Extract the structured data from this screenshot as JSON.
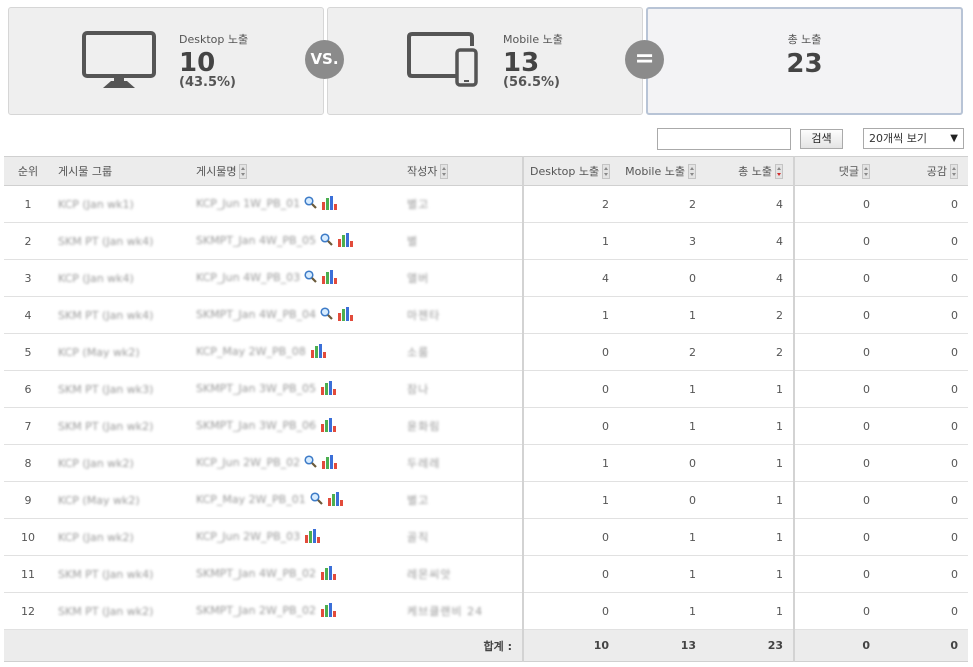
{
  "summary": {
    "desktop": {
      "label": "Desktop 노출",
      "count": "10",
      "pct": "(43.5%)"
    },
    "vs_label": "VS.",
    "mobile": {
      "label": "Mobile 노출",
      "count": "13",
      "pct": "(56.5%)"
    },
    "eq_label": "=",
    "total": {
      "label": "총 노출",
      "count": "23"
    }
  },
  "toolbar": {
    "search_value": "",
    "search_button": "검색",
    "pagesize": "20개씩 보기",
    "pagesize_arrow": "▼"
  },
  "table": {
    "headers": {
      "rank": "순위",
      "group": "게시물 그룹",
      "name": "게시물명",
      "author": "작성자",
      "desktop": "Desktop 노출",
      "mobile": "Mobile 노출",
      "total": "총 노출",
      "comments": "댓글",
      "likes": "공감"
    },
    "rows": [
      {
        "rank": "1",
        "group": "KCP (Jan wk1)",
        "name": "KCP_Jun 1W_PB_01",
        "author": "별고",
        "search": true,
        "desktop": "2",
        "mobile": "2",
        "total": "4",
        "comments": "0",
        "likes": "0"
      },
      {
        "rank": "2",
        "group": "SKM PT (Jan wk4)",
        "name": "SKMPT_Jan 4W_PB_05",
        "author": "별",
        "search": true,
        "desktop": "1",
        "mobile": "3",
        "total": "4",
        "comments": "0",
        "likes": "0"
      },
      {
        "rank": "3",
        "group": "KCP (Jan wk4)",
        "name": "KCP_Jun 4W_PB_03",
        "author": "앨버",
        "search": true,
        "desktop": "4",
        "mobile": "0",
        "total": "4",
        "comments": "0",
        "likes": "0"
      },
      {
        "rank": "4",
        "group": "SKM PT (Jan wk4)",
        "name": "SKMPT_Jan 4W_PB_04",
        "author": "마젠타",
        "search": true,
        "desktop": "1",
        "mobile": "1",
        "total": "2",
        "comments": "0",
        "likes": "0"
      },
      {
        "rank": "5",
        "group": "KCP (May wk2)",
        "name": "KCP_May 2W_PB_08",
        "author": "소룸",
        "search": false,
        "desktop": "0",
        "mobile": "2",
        "total": "2",
        "comments": "0",
        "likes": "0"
      },
      {
        "rank": "6",
        "group": "SKM PT (Jan wk3)",
        "name": "SKMPT_Jan 3W_PB_05",
        "author": "잠나",
        "search": false,
        "desktop": "0",
        "mobile": "1",
        "total": "1",
        "comments": "0",
        "likes": "0"
      },
      {
        "rank": "7",
        "group": "SKM PT (Jan wk2)",
        "name": "SKMPT_Jan 3W_PB_06",
        "author": "윤화림",
        "search": false,
        "desktop": "0",
        "mobile": "1",
        "total": "1",
        "comments": "0",
        "likes": "0"
      },
      {
        "rank": "8",
        "group": "KCP (Jan wk2)",
        "name": "KCP_Jun 2W_PB_02",
        "author": "두레레",
        "search": true,
        "desktop": "1",
        "mobile": "0",
        "total": "1",
        "comments": "0",
        "likes": "0"
      },
      {
        "rank": "9",
        "group": "KCP (May wk2)",
        "name": "KCP_May 2W_PB_01",
        "author": "별고",
        "search": true,
        "desktop": "1",
        "mobile": "0",
        "total": "1",
        "comments": "0",
        "likes": "0"
      },
      {
        "rank": "10",
        "group": "KCP (Jan wk2)",
        "name": "KCP_Jun 2W_PB_03",
        "author": "골직",
        "search": false,
        "desktop": "0",
        "mobile": "1",
        "total": "1",
        "comments": "0",
        "likes": "0"
      },
      {
        "rank": "11",
        "group": "SKM PT (Jan wk4)",
        "name": "SKMPT_Jan 4W_PB_02",
        "author": "레몬씨앗",
        "search": false,
        "desktop": "0",
        "mobile": "1",
        "total": "1",
        "comments": "0",
        "likes": "0"
      },
      {
        "rank": "12",
        "group": "SKM PT (Jan wk2)",
        "name": "SKMPT_Jan 2W_PB_02",
        "author": "케브클랜비 24",
        "search": false,
        "desktop": "0",
        "mobile": "1",
        "total": "1",
        "comments": "0",
        "likes": "0"
      }
    ],
    "footer": {
      "label": "합계 :",
      "desktop": "10",
      "mobile": "13",
      "total": "23",
      "comments": "0",
      "likes": "0"
    }
  },
  "colors": {
    "accent_sort": "#d12c2c",
    "total_card_border": "#b8c4d6",
    "chart_red": "#e24b3b",
    "chart_green": "#4caf50",
    "chart_blue": "#3b6fd8"
  }
}
